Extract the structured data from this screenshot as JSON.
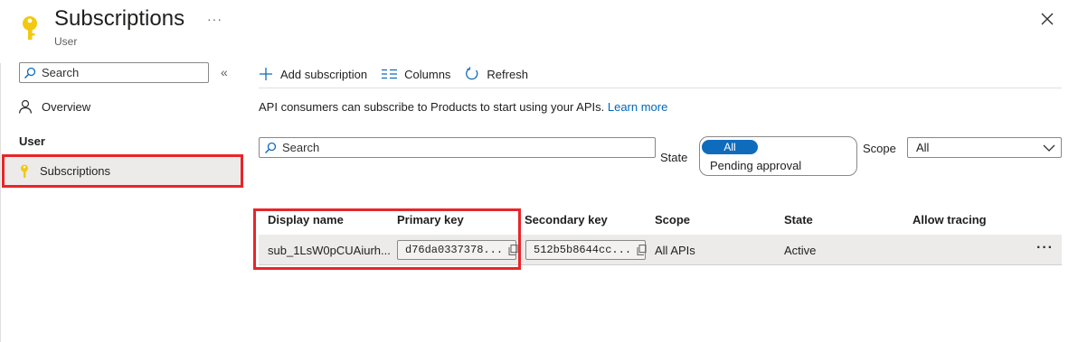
{
  "header": {
    "title": "Subscriptions",
    "subtitle": "User",
    "more_label": "···"
  },
  "left_nav": {
    "search_placeholder": "Search",
    "collapse_label": "«",
    "overview_label": "Overview",
    "section_label": "User",
    "subscriptions_label": "Subscriptions"
  },
  "toolbar": {
    "add_label": "Add subscription",
    "columns_label": "Columns",
    "refresh_label": "Refresh"
  },
  "info": {
    "text": "API consumers can subscribe to Products to start using your APIs.",
    "link": "Learn more"
  },
  "filters": {
    "search_placeholder": "Search",
    "state_label": "State",
    "state_options": [
      "All",
      "Pending approval"
    ],
    "scope_label": "Scope",
    "scope_value": "All"
  },
  "table": {
    "columns": [
      "Display name",
      "Primary key",
      "Secondary key",
      "Scope",
      "State",
      "Allow tracing"
    ],
    "rows": [
      {
        "display_name": "sub_1LsW0pCUAiurh...",
        "primary_key": "d76da0337378...",
        "secondary_key": "512b5b8644cc...",
        "scope": "All APIs",
        "state": "Active",
        "allow_tracing": "",
        "more": "···"
      }
    ]
  },
  "colors": {
    "accent": "#0f6cbd",
    "link": "#0067b8",
    "highlight": "#e8252a",
    "selected_bg": "#edebe9"
  }
}
